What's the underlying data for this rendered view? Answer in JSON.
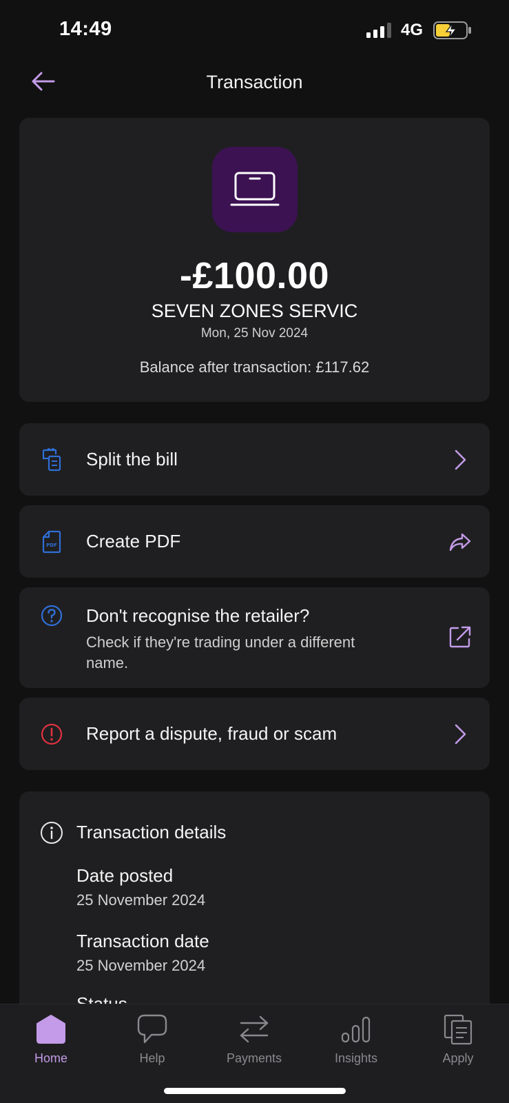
{
  "status_bar": {
    "time": "14:49",
    "network": "4G"
  },
  "nav": {
    "title": "Transaction"
  },
  "summary": {
    "icon": "laptop-icon",
    "amount": "-£100.00",
    "merchant": "SEVEN ZONES SERVIC",
    "date": "Mon, 25 Nov 2024",
    "balance": "Balance after transaction: £117.62"
  },
  "actions": [
    {
      "label": "Split the bill",
      "icon": "receipt-icon",
      "trailing": "chevron-right-icon"
    },
    {
      "label": "Create PDF",
      "icon": "pdf-document-icon",
      "trailing": "share-icon"
    },
    {
      "label": "Don't recognise the retailer?",
      "subtitle": "Check if they're trading under a different name.",
      "icon": "question-circle-icon",
      "trailing": "external-link-icon"
    },
    {
      "label": "Report a dispute, fraud or scam",
      "icon": "alert-circle-icon",
      "trailing": "chevron-right-icon"
    }
  ],
  "details": {
    "title": "Transaction details",
    "items": [
      {
        "label": "Date posted",
        "value": "25 November 2024"
      },
      {
        "label": "Transaction date",
        "value": "25 November 2024"
      },
      {
        "label": "Status",
        "value": ""
      }
    ]
  },
  "tabs": [
    {
      "label": "Home",
      "icon": "home-icon",
      "active": true
    },
    {
      "label": "Help",
      "icon": "chat-bubble-icon",
      "active": false
    },
    {
      "label": "Payments",
      "icon": "transfer-arrows-icon",
      "active": false
    },
    {
      "label": "Insights",
      "icon": "insights-bars-icon",
      "active": false
    },
    {
      "label": "Apply",
      "icon": "documents-icon",
      "active": false
    }
  ],
  "colors": {
    "background": "#111111",
    "card": "#1f1f21",
    "accent": "#c39be8",
    "icon_blue": "#2f6fd6",
    "icon_red": "#e0313f",
    "merchant_icon_bg": "#3c1253",
    "battery_fill": "#f7d038"
  }
}
